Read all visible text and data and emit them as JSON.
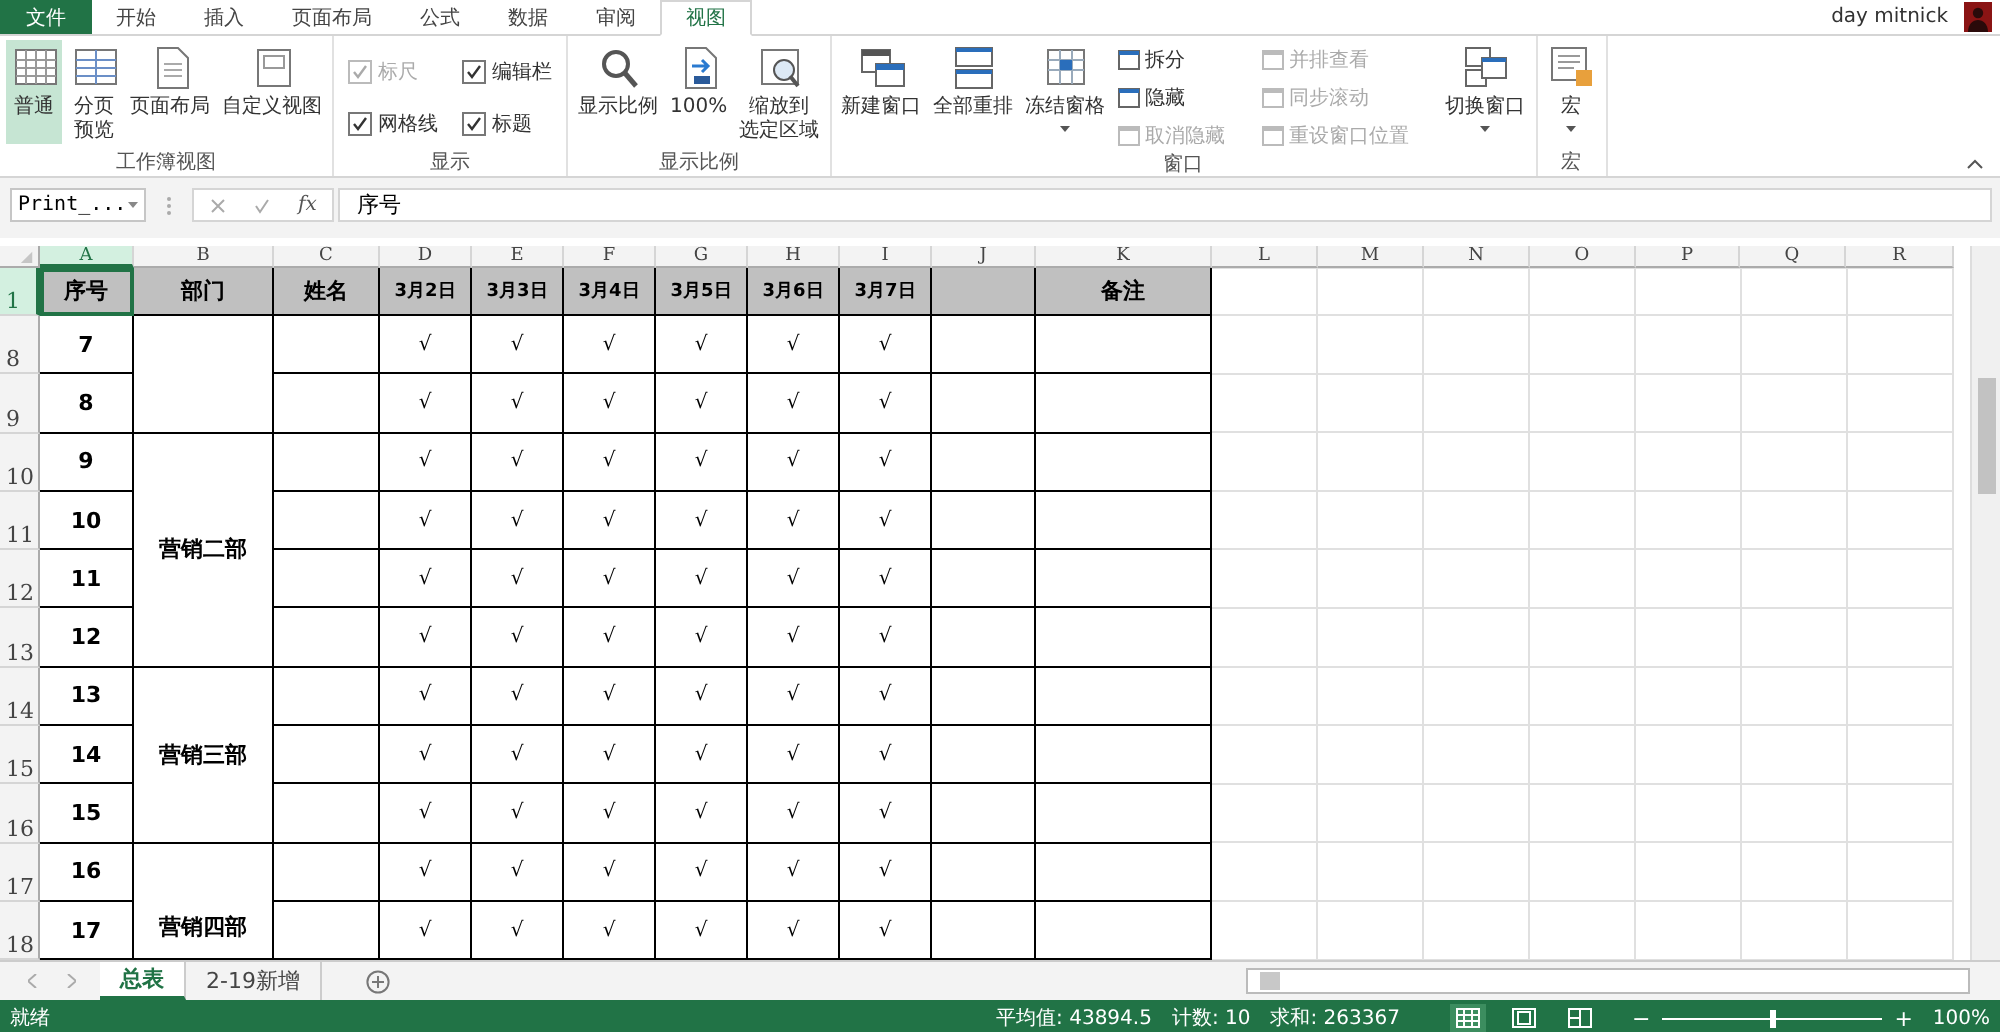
{
  "ribbon_tabs": [
    {
      "label": "文件",
      "kind": "file",
      "selected": false
    },
    {
      "label": "开始",
      "kind": "tab",
      "selected": false
    },
    {
      "label": "插入",
      "kind": "tab",
      "selected": false
    },
    {
      "label": "页面布局",
      "kind": "tab",
      "selected": false
    },
    {
      "label": "公式",
      "kind": "tab",
      "selected": false
    },
    {
      "label": "数据",
      "kind": "tab",
      "selected": false
    },
    {
      "label": "审阅",
      "kind": "tab",
      "selected": false
    },
    {
      "label": "视图",
      "kind": "tab",
      "selected": true
    }
  ],
  "user": {
    "name": "day mitnick"
  },
  "ribbon_groups": [
    {
      "label": "工作簿视图",
      "items": [
        {
          "kind": "large",
          "label": "普通",
          "selected": true
        },
        {
          "kind": "large",
          "label": [
            "分页",
            "预览"
          ],
          "selected": false
        },
        {
          "kind": "large",
          "label": "页面布局",
          "selected": false
        },
        {
          "kind": "large",
          "label": "自定义视图",
          "selected": false
        }
      ]
    },
    {
      "label": "显示",
      "items": [
        {
          "kind": "check",
          "label": "标尺",
          "checked": true,
          "disabled": true
        },
        {
          "kind": "check",
          "label": "编辑栏",
          "checked": true,
          "disabled": false
        },
        {
          "kind": "check",
          "label": "网格线",
          "checked": true,
          "disabled": false
        },
        {
          "kind": "check",
          "label": "标题",
          "checked": true,
          "disabled": false
        }
      ]
    },
    {
      "label": "显示比例",
      "items": [
        {
          "kind": "large",
          "label": "显示比例",
          "selected": false
        },
        {
          "kind": "large",
          "label": "100%",
          "selected": false
        },
        {
          "kind": "large",
          "label": [
            "缩放到",
            "选定区域"
          ],
          "selected": false
        }
      ]
    },
    {
      "label": "窗口",
      "items": [
        {
          "kind": "large",
          "label": "新建窗口",
          "selected": false
        },
        {
          "kind": "large",
          "label": "全部重排",
          "selected": false
        },
        {
          "kind": "large",
          "label": "冻结窗格",
          "selected": false
        },
        {
          "kind": "small",
          "label": "拆分",
          "disabled": false
        },
        {
          "kind": "small",
          "label": "隐藏",
          "disabled": false
        },
        {
          "kind": "small",
          "label": "取消隐藏",
          "disabled": true
        },
        {
          "kind": "small",
          "label": "并排查看",
          "disabled": true
        },
        {
          "kind": "small",
          "label": "同步滚动",
          "disabled": true
        },
        {
          "kind": "small",
          "label": "重设窗口位置",
          "disabled": true
        },
        {
          "kind": "large",
          "label": "切换窗口",
          "selected": false
        }
      ]
    },
    {
      "label": "宏",
      "items": [
        {
          "kind": "large",
          "label": "宏",
          "selected": false
        }
      ]
    }
  ],
  "formula_bar": {
    "name_box": "Print_...",
    "function_label": "fx",
    "value": "序号"
  },
  "columns": [
    {
      "label": "A",
      "selected": true
    },
    {
      "label": "B",
      "selected": false
    },
    {
      "label": "C",
      "selected": false
    },
    {
      "label": "D",
      "selected": false
    },
    {
      "label": "E",
      "selected": false
    },
    {
      "label": "F",
      "selected": false
    },
    {
      "label": "G",
      "selected": false
    },
    {
      "label": "H",
      "selected": false
    },
    {
      "label": "I",
      "selected": false
    },
    {
      "label": "J",
      "selected": false
    },
    {
      "label": "K",
      "selected": false
    },
    {
      "label": "L",
      "selected": false
    },
    {
      "label": "M",
      "selected": false
    },
    {
      "label": "N",
      "selected": false
    },
    {
      "label": "O",
      "selected": false
    },
    {
      "label": "P",
      "selected": false
    },
    {
      "label": "Q",
      "selected": false
    },
    {
      "label": "R",
      "selected": false
    }
  ],
  "header_row": {
    "row_number": "1",
    "selected": true,
    "cells": [
      "序号",
      "部门",
      "姓名",
      "3月2日",
      "3月3日",
      "3月4日",
      "3月5日",
      "3月6日",
      "3月7日",
      null,
      "备注"
    ]
  },
  "groups": [
    {
      "rows": [
        {
          "row_number": "8",
          "seq": "7",
          "marks": [
            "√",
            "√",
            "√",
            "√",
            "√",
            "√"
          ]
        },
        {
          "row_number": "9",
          "seq": "8",
          "marks": [
            "√",
            "√",
            "√",
            "√",
            "√",
            "√"
          ]
        }
      ]
    },
    {
      "department": "营销二部",
      "rows": [
        {
          "row_number": "10",
          "seq": "9",
          "marks": [
            "√",
            "√",
            "√",
            "√",
            "√",
            "√"
          ]
        },
        {
          "row_number": "11",
          "seq": "10",
          "marks": [
            "√",
            "√",
            "√",
            "√",
            "√",
            "√"
          ]
        },
        {
          "row_number": "12",
          "seq": "11",
          "marks": [
            "√",
            "√",
            "√",
            "√",
            "√",
            "√"
          ]
        },
        {
          "row_number": "13",
          "seq": "12",
          "marks": [
            "√",
            "√",
            "√",
            "√",
            "√",
            "√"
          ]
        }
      ]
    },
    {
      "department": "营销三部",
      "rows": [
        {
          "row_number": "14",
          "seq": "13",
          "marks": [
            "√",
            "√",
            "√",
            "√",
            "√",
            "√"
          ]
        },
        {
          "row_number": "15",
          "seq": "14",
          "marks": [
            "√",
            "√",
            "√",
            "√",
            "√",
            "√"
          ]
        },
        {
          "row_number": "16",
          "seq": "15",
          "marks": [
            "√",
            "√",
            "√",
            "√",
            "√",
            "√"
          ]
        }
      ]
    },
    {
      "department": "营销四部",
      "rows": [
        {
          "row_number": "17",
          "seq": "16",
          "marks": [
            "√",
            "√",
            "√",
            "√",
            "√",
            "√"
          ]
        },
        {
          "row_number": "18",
          "seq": "17",
          "marks": [
            "√",
            "√",
            "√",
            "√",
            "√",
            "√"
          ]
        }
      ]
    }
  ],
  "sheet_tabs": [
    {
      "label": "总表",
      "selected": true
    },
    {
      "label": "2-19新增",
      "selected": false
    }
  ],
  "status_bar": {
    "status": "就绪",
    "average": "平均值: 43894.5",
    "count": "计数: 10",
    "sum": "求和: 263367",
    "views": [
      {
        "selected": true
      },
      {
        "selected": false
      },
      {
        "selected": false
      }
    ],
    "zoom": {
      "minus": "−",
      "plus": "+",
      "level": 0.5,
      "reading": "100%"
    }
  }
}
